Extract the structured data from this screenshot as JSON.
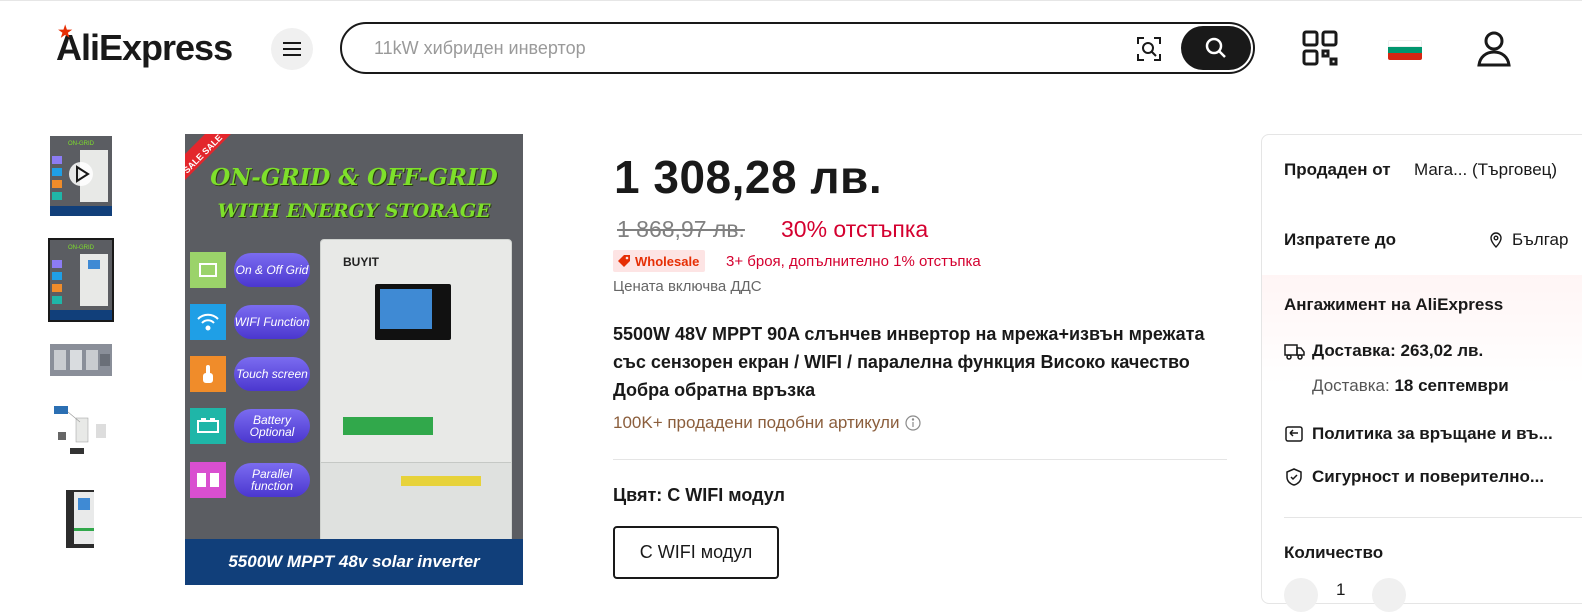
{
  "header": {
    "logo_text": "AliExpress",
    "search_placeholder": "11kW хибриден инвертор",
    "icons": [
      "menu-icon",
      "camera-search-icon",
      "search-icon",
      "qr-code-icon",
      "flag-icon",
      "user-icon"
    ],
    "flag_colors": [
      "#ffffff",
      "#00966e",
      "#d62612"
    ]
  },
  "gallery": {
    "thumbnails": [
      "thumb-1",
      "thumb-2",
      "thumb-3",
      "thumb-4",
      "thumb-5"
    ],
    "active_index": 1,
    "main_image": {
      "title_line1": "ON-GRID & OFF-GRID",
      "title_line2": "WITH ENERGY STORAGE",
      "sale_text": "SALE SALE",
      "features": [
        "On & Off Grid",
        "WIFI Function",
        "Touch screen",
        "Battery Optional",
        "Parallel function"
      ],
      "brand": "BUYIT",
      "banner": "5500W MPPT 48v solar inverter"
    }
  },
  "product": {
    "price": "1 308,28 лв.",
    "old_price": "1 868,97 лв.",
    "discount": "30% отстъпка",
    "wholesale_badge": "Wholesale",
    "wholesale_text": "3+ броя, допълнително 1% отстъпка",
    "vat_note": "Цената включва ДДС",
    "title": "5500W 48V MPPT 90A слънчев инвертор на мрежа+извън мрежата със сензорен екран / WIFI / паралелна функция Високо качество Добра обратна връзка",
    "sold_count": "100K+ продадени подобни артикули",
    "color_label": "Цвят: С WIFI модул",
    "color_option": "С WIFI модул"
  },
  "side_panel": {
    "sold_by_label": "Продаден от",
    "sold_by_value": "Мага... (Търговец)",
    "ship_to_label": "Изпратете до",
    "ship_to_value": "Българ",
    "commitment_title": "Ангажимент на AliExpress",
    "delivery_cost": "Доставка: 263,02 лв.",
    "delivery_date_label": "Доставка:",
    "delivery_date_value": "18 септември",
    "return_policy": "Политика за връщане и въ...",
    "security": "Сигурност и поверително...",
    "quantity_label": "Количество",
    "quantity_value": "1"
  },
  "colors": {
    "accent_red": "#d4002f",
    "brand_red": "#e62e04",
    "dark": "#191919"
  }
}
